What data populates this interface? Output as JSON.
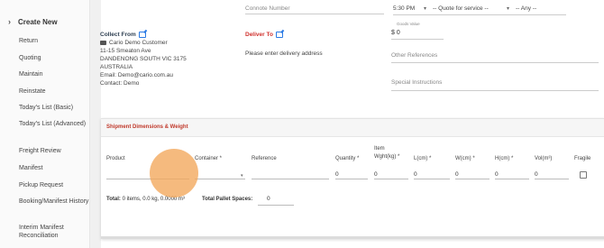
{
  "sidebar": {
    "create_new": "Create New",
    "items": [
      {
        "label": "Return"
      },
      {
        "label": "Quoting"
      },
      {
        "label": "Maintain"
      },
      {
        "label": "Reinstate"
      },
      {
        "label": "Today's List (Basic)"
      },
      {
        "label": "Today's List (Advanced)"
      },
      {
        "label": "Freight Review"
      },
      {
        "label": "Manifest"
      },
      {
        "label": "Pickup Request"
      },
      {
        "label": "Booking/Manifest History"
      },
      {
        "label": "Interim Manifest Reconciliation"
      }
    ]
  },
  "top": {
    "consignment_placeholder": "Connote Number",
    "time": "5:30 PM",
    "quote": "-- Quote for service --",
    "any": "-- Any --",
    "goods_value_label": "Goods Value",
    "goods_value": "$ 0"
  },
  "collect_from": {
    "title": "Collect From",
    "name": "Cario Demo Customer",
    "street": "11-15 Smeaton Ave",
    "suburb": "DANDENONG SOUTH VIC 3175",
    "country": "AUSTRALIA",
    "email": "Email: Demo@cario.com.au",
    "contact": "Contact: Demo"
  },
  "deliver_to": {
    "title": "Deliver To",
    "hint": "Please enter delivery address"
  },
  "references": {
    "other_placeholder": "Other References",
    "special_placeholder": "Special Instructions"
  },
  "shipment": {
    "title": "Shipment Dimensions & Weight",
    "columns": {
      "product": "Product",
      "container": "Container *",
      "reference": "Reference",
      "quantity": "Quantity *",
      "item_weight_1": "Item",
      "item_weight_2": "Wght(kg) *",
      "length": "L(cm) *",
      "width": "W(cm) *",
      "height": "H(cm) *",
      "volume": "Vol(m³)",
      "fragile": "Fragile"
    },
    "row": {
      "quantity": "0",
      "weight": "0",
      "length": "0",
      "width": "0",
      "height": "0",
      "volume": "0"
    },
    "totals_label": "Total:",
    "totals_value": "0 items, 0.0 kg, 0.0000 m³",
    "pallet_label": "Total Pallet Spaces:",
    "pallet_value": "0"
  },
  "colors": {
    "deliver_to": "#d0312d",
    "section_title": "#c0392b",
    "edit_icon": "#2a7ae4",
    "cursor": "#f2a65a"
  }
}
